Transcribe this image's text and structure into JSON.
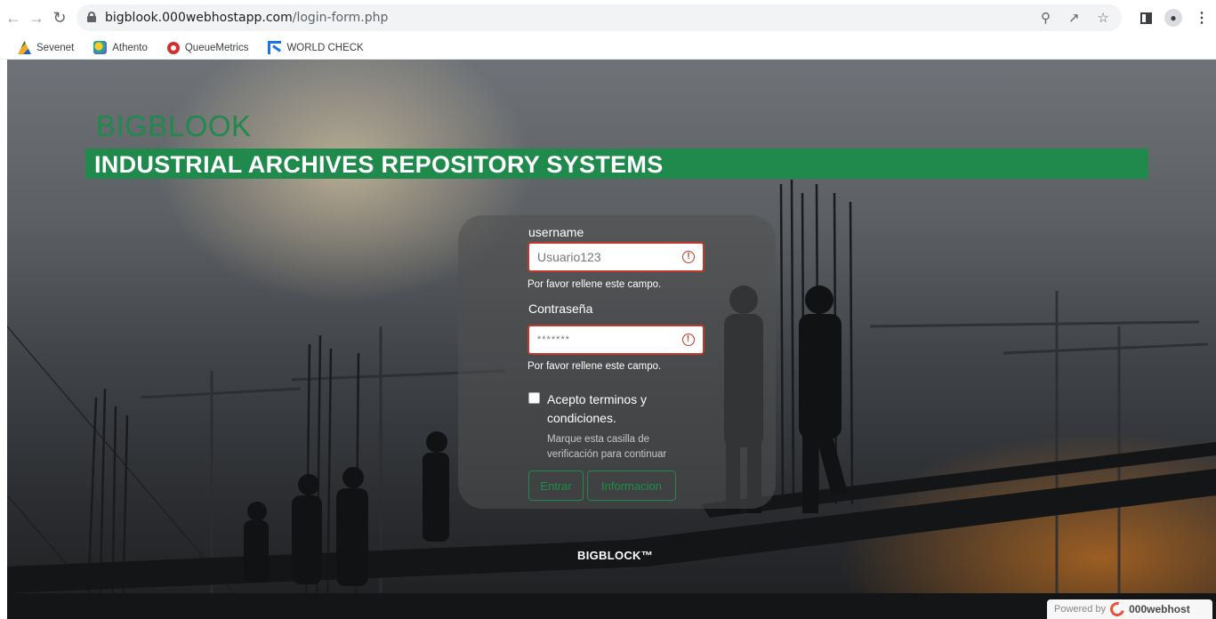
{
  "browser": {
    "url_host": "bigblook.000webhostapp.com",
    "url_path": "/login-form.php",
    "bookmarks": [
      {
        "label": "Sevenet",
        "icon": "sevenet-icon"
      },
      {
        "label": "Athento",
        "icon": "athento-icon"
      },
      {
        "label": "QueueMetrics",
        "icon": "queuemetrics-icon"
      },
      {
        "label": "WORLD CHECK",
        "icon": "world-check-icon"
      }
    ]
  },
  "header": {
    "brand": "BIGBLOOK",
    "banner": "INDUSTRIAL ARCHIVES REPOSITORY SYSTEMS",
    "accent_color": "#1f8a4c"
  },
  "login": {
    "username_label": "username",
    "username_value": "Usuario123",
    "username_hint": "Por favor rellene este campo.",
    "password_label": "Contraseña",
    "password_value": "*******",
    "password_hint": "Por favor rellene este campo.",
    "terms_label": "Acepto terminos y condiciones.",
    "terms_help": "Marque esta casilla de verificación para continuar",
    "enter_button": "Entrar",
    "info_button": "Informacion",
    "error_color": "#c0392b"
  },
  "footer": {
    "text": "BIGBLOCK™"
  },
  "powered": {
    "prefix": "Powered by",
    "brand": "000webhost"
  }
}
